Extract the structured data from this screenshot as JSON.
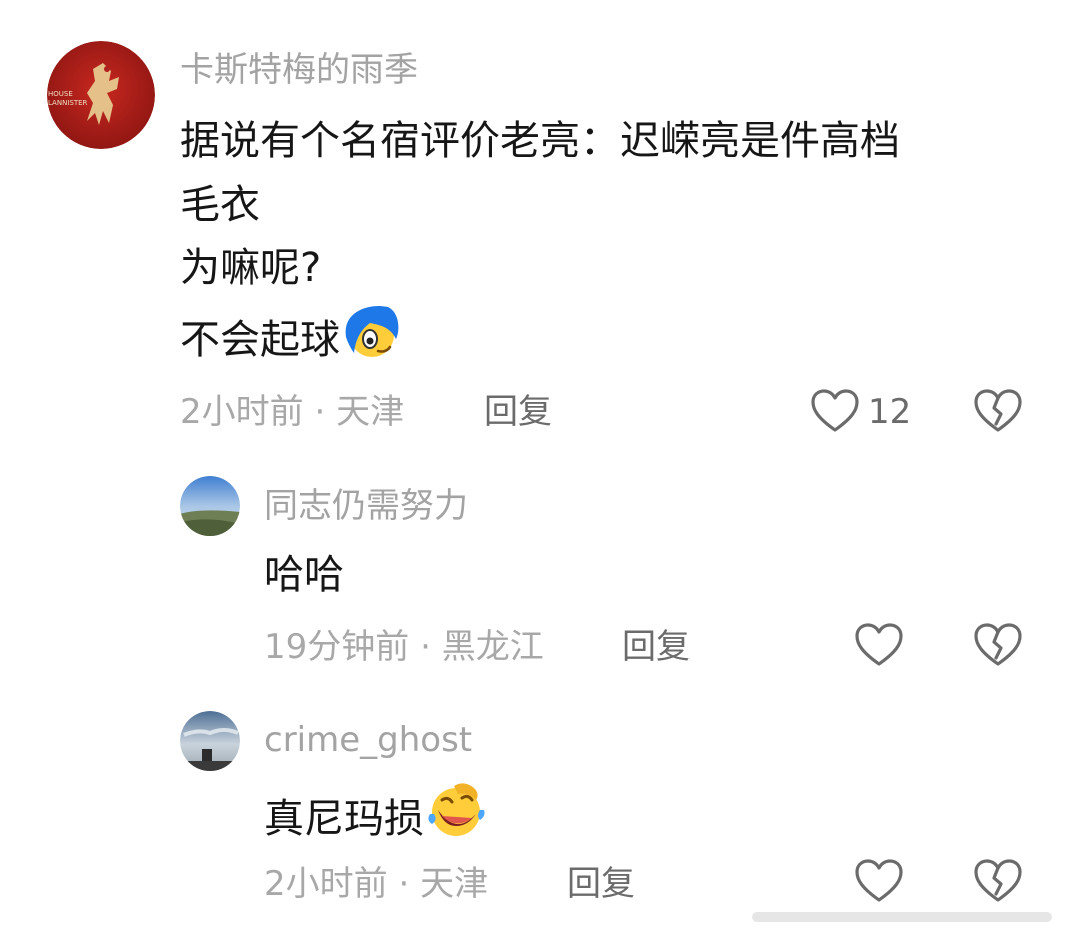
{
  "comments": [
    {
      "username": "卡斯特梅的雨季",
      "text_lines": [
        "据说有个名宿评价老亮：迟嵘亮是件高档",
        "毛衣",
        "为嘛呢?",
        "不会起球"
      ],
      "emoji": "cool-dude-emoji",
      "time": "2小时前",
      "separator": "·",
      "location": "天津",
      "reply_label": "回复",
      "like_count": "12",
      "avatar_badge": "HOUSE LANNISTER"
    },
    {
      "username": "同志仍需努力",
      "text": "哈哈",
      "time": "19分钟前",
      "separator": "·",
      "location": "黑龙江",
      "reply_label": "回复"
    },
    {
      "username": "crime_ghost",
      "text": "真尼玛损",
      "emoji": "laughing-crying-emoji",
      "time": "2小时前",
      "separator": "·",
      "location": "天津",
      "reply_label": "回复"
    }
  ],
  "icons": {
    "like": "heart-outline-icon",
    "dislike": "broken-heart-icon"
  },
  "colors": {
    "text": "#161616",
    "muted": "#a3a3a3",
    "icon": "#6b6b6b",
    "avatar_red": "#b0201c"
  }
}
